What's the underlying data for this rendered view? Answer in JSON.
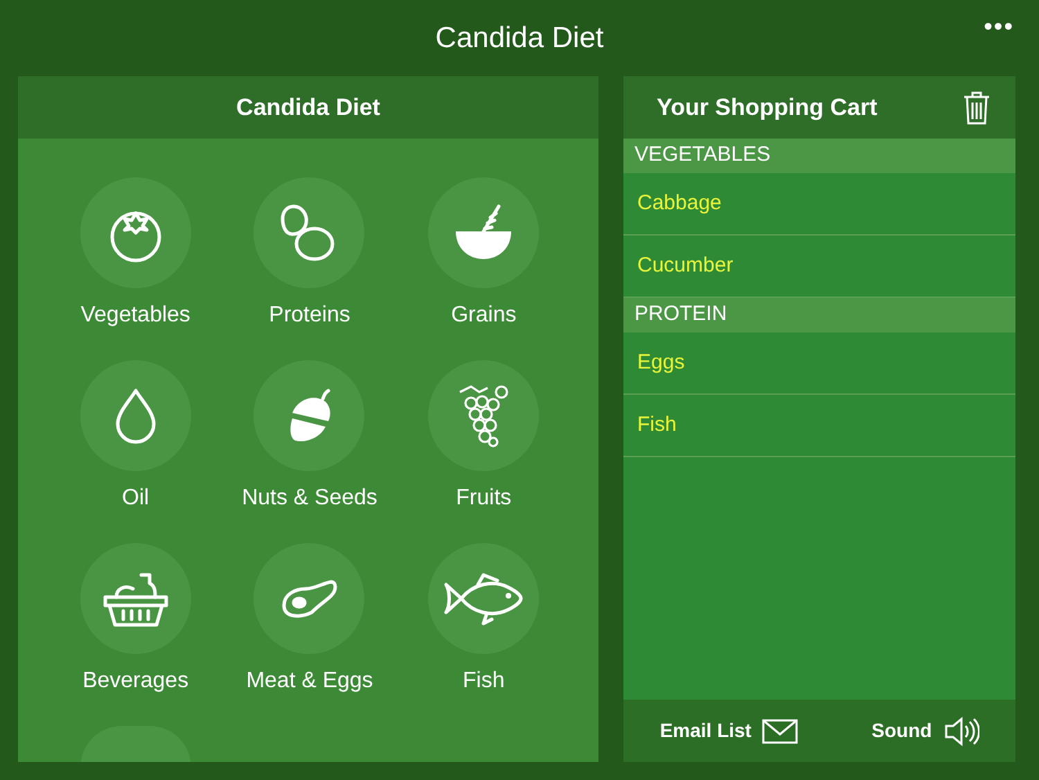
{
  "window": {
    "title": "Candida Diet",
    "menu": "•••"
  },
  "categories_panel": {
    "title": "Candida Diet",
    "more_below": true,
    "categories": [
      {
        "label": "Vegetables",
        "kind": "tomato"
      },
      {
        "label": "Proteins",
        "kind": "eggs"
      },
      {
        "label": "Grains",
        "kind": "grain-bowl"
      },
      {
        "label": "Oil",
        "kind": "drop"
      },
      {
        "label": "Nuts & Seeds",
        "kind": "acorn"
      },
      {
        "label": "Fruits",
        "kind": "grapes"
      },
      {
        "label": "Beverages",
        "kind": "basket"
      },
      {
        "label": "Meat & Eggs",
        "kind": "steak"
      },
      {
        "label": "Fish",
        "kind": "fish"
      }
    ]
  },
  "cart": {
    "title": "Your Shopping Cart",
    "sections": [
      {
        "heading": "VEGETABLES",
        "items": [
          "Cabbage",
          "Cucumber"
        ]
      },
      {
        "heading": "PROTEIN",
        "items": [
          "Eggs",
          "Fish"
        ]
      }
    ]
  },
  "footer": {
    "buttons": [
      {
        "label": "Email List",
        "kind": "email"
      },
      {
        "label": "Sound",
        "kind": "sound"
      }
    ]
  }
}
